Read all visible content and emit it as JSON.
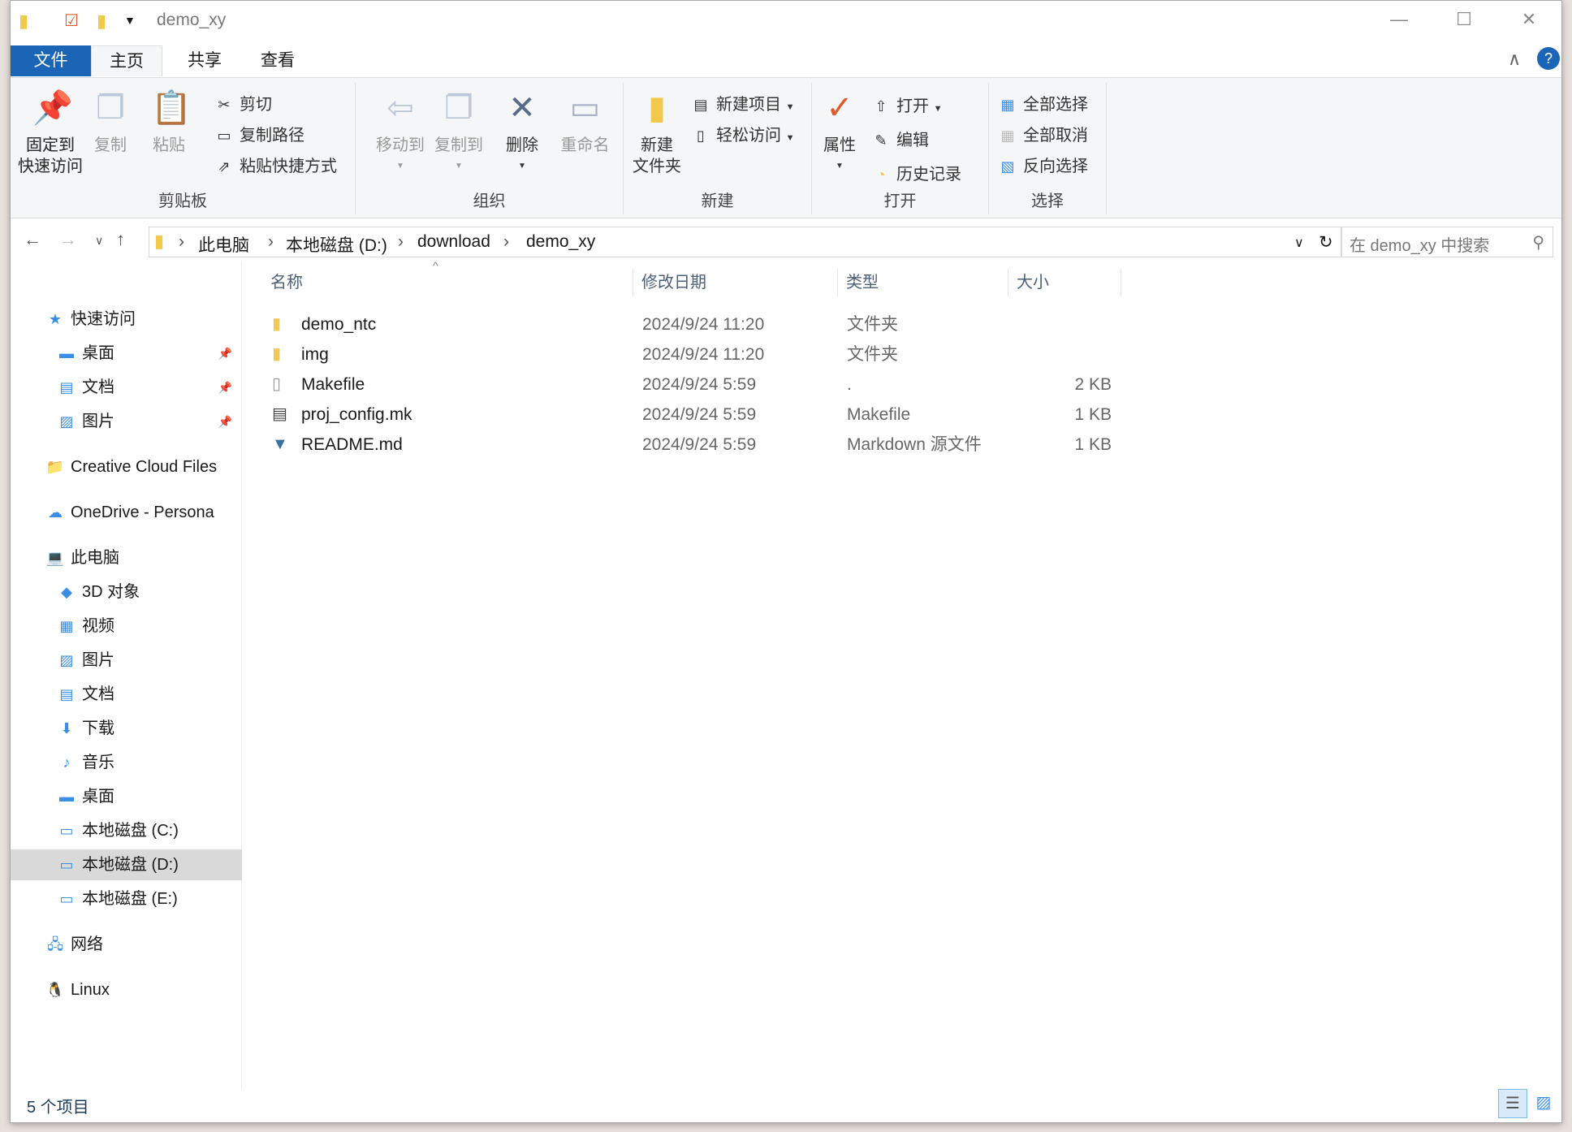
{
  "window": {
    "title": "demo_xy",
    "minimize": "—",
    "maximize": "☐",
    "close": "✕"
  },
  "tabs": [
    {
      "label": "文件"
    },
    {
      "label": "主页"
    },
    {
      "label": "共享"
    },
    {
      "label": "查看"
    }
  ],
  "ribbon": {
    "clipboard": {
      "label": "剪贴板",
      "pin": "固定到\n快速访问",
      "pin1": "固定到",
      "pin2": "快速访问",
      "copy": "复制",
      "paste": "粘贴",
      "cut": "剪切",
      "copy_path": "复制路径",
      "paste_shortcut": "粘贴快捷方式"
    },
    "organize": {
      "label": "组织",
      "move_to": "移动到",
      "copy_to": "复制到",
      "delete": "删除",
      "rename": "重命名"
    },
    "new": {
      "label": "新建",
      "new_folder1": "新建",
      "new_folder2": "文件夹",
      "new_item": "新建项目",
      "easy_access": "轻松访问"
    },
    "open": {
      "label": "打开",
      "properties": "属性",
      "open": "打开",
      "edit": "编辑",
      "history": "历史记录"
    },
    "select": {
      "label": "选择",
      "select_all": "全部选择",
      "select_none": "全部取消",
      "invert": "反向选择"
    }
  },
  "address": {
    "crumbs": [
      "此电脑",
      "本地磁盘 (D:)",
      "download",
      "demo_xy"
    ],
    "search_placeholder": "在 demo_xy 中搜索"
  },
  "sidebar": [
    {
      "label": "快速访问",
      "icon": "★",
      "pinned": false
    },
    {
      "label": "桌面",
      "icon": "▬",
      "pinned": true
    },
    {
      "label": "文档",
      "icon": "▤",
      "pinned": true
    },
    {
      "label": "图片",
      "icon": "▨",
      "pinned": true
    },
    {
      "label": "Creative Cloud Files",
      "icon": "📁"
    },
    {
      "label": "OneDrive - Persona",
      "icon": "☁"
    },
    {
      "label": "此电脑",
      "icon": "💻"
    },
    {
      "label": "3D 对象",
      "icon": "◆"
    },
    {
      "label": "视频",
      "icon": "▦"
    },
    {
      "label": "图片",
      "icon": "▨"
    },
    {
      "label": "文档",
      "icon": "▤"
    },
    {
      "label": "下载",
      "icon": "⬇"
    },
    {
      "label": "音乐",
      "icon": "♪"
    },
    {
      "label": "桌面",
      "icon": "▬"
    },
    {
      "label": "本地磁盘 (C:)",
      "icon": "▭"
    },
    {
      "label": "本地磁盘 (D:)",
      "icon": "▭",
      "selected": true
    },
    {
      "label": "本地磁盘 (E:)",
      "icon": "▭"
    },
    {
      "label": "网络",
      "icon": "🖧"
    },
    {
      "label": "Linux",
      "icon": "🐧"
    }
  ],
  "columns": {
    "name": "名称",
    "date": "修改日期",
    "type": "类型",
    "size": "大小"
  },
  "files": [
    {
      "name": "demo_ntc",
      "date": "2024/9/24 11:20",
      "type": "文件夹",
      "size": "",
      "icon": "folder"
    },
    {
      "name": "img",
      "date": "2024/9/24 11:20",
      "type": "文件夹",
      "size": "",
      "icon": "folder"
    },
    {
      "name": "Makefile",
      "date": "2024/9/24 5:59",
      "type": ".",
      "size": "2 KB",
      "icon": "file"
    },
    {
      "name": "proj_config.mk",
      "date": "2024/9/24 5:59",
      "type": "Makefile",
      "size": "1 KB",
      "icon": "mk-file"
    },
    {
      "name": "README.md",
      "date": "2024/9/24 5:59",
      "type": "Markdown 源文件",
      "size": "1 KB",
      "icon": "md-file"
    }
  ],
  "status": {
    "count": "5 个项目"
  },
  "colors": {
    "accent": "#1a65b5",
    "folder": "#f2c94c",
    "ribbon_bg": "#f5f6f7"
  }
}
